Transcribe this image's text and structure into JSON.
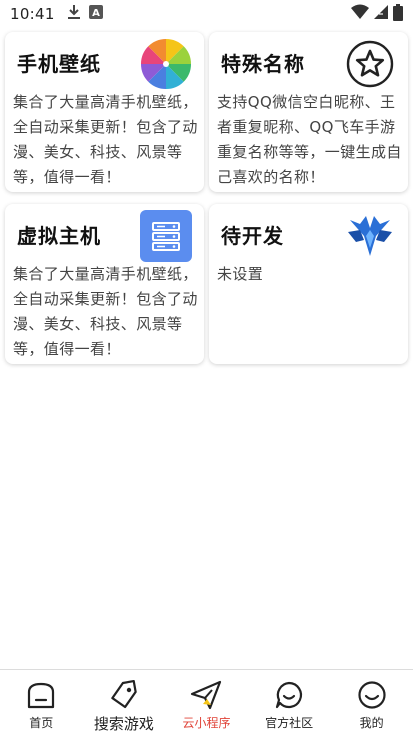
{
  "status_bar": {
    "time": "10:41"
  },
  "cards": [
    {
      "title": "手机壁纸",
      "desc": "集合了大量高清手机壁纸，全自动采集更新！包含了动漫、美女、科技、风景等等，值得一看！",
      "icon": "pinwheel-icon"
    },
    {
      "title": "特殊名称",
      "desc": "支持QQ微信空白昵称、王者重复昵称、QQ飞车手游重复名称等等，一键生成自己喜欢的名称！",
      "icon": "star-badge-icon"
    },
    {
      "title": "虚拟主机",
      "desc": "集合了大量高清手机壁纸，全自动采集更新！包含了动漫、美女、科技、风景等等，值得一看！",
      "icon": "server-icon"
    },
    {
      "title": "待开发",
      "desc": "未设置",
      "icon": "wings-logo-icon"
    }
  ],
  "tabbar": {
    "items": [
      {
        "label": "首页",
        "icon": "home-icon"
      },
      {
        "label": "搜索游戏",
        "icon": "tag-icon"
      },
      {
        "label": "云小程序",
        "icon": "paper-plane-icon",
        "active": true
      },
      {
        "label": "官方社区",
        "icon": "chat-smile-icon"
      },
      {
        "label": "我的",
        "icon": "smile-icon"
      }
    ]
  },
  "colors": {
    "accent": "#e0453a",
    "server_icon_bg": "#5b8def",
    "wings_logo": "#2a6fd6"
  }
}
